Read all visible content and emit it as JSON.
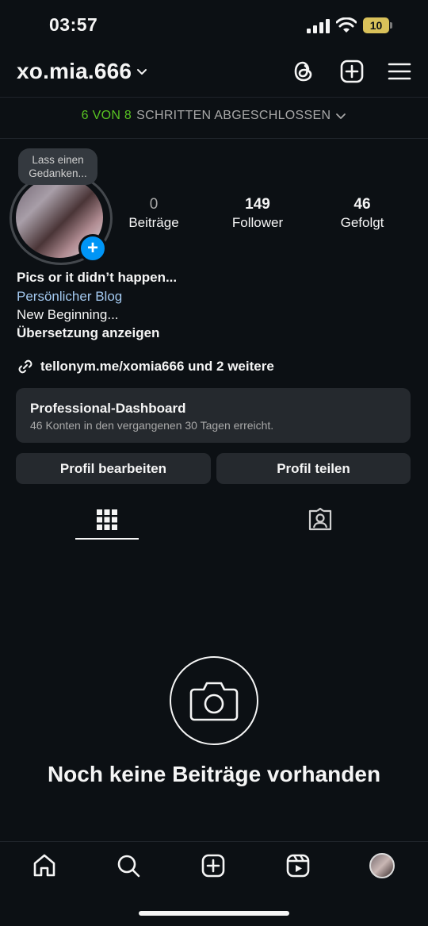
{
  "status_bar": {
    "time": "03:57",
    "battery": "10"
  },
  "header": {
    "username": "xo.mia.666",
    "icons": [
      "threads-icon",
      "create-post-icon",
      "menu-icon"
    ]
  },
  "steps": {
    "done": "6 VON 8",
    "rest": "SCHRITTEN ABGESCHLOSSEN"
  },
  "profile": {
    "note_bubble": "Lass einen Gedanken...",
    "stats": [
      {
        "value": "0",
        "label": "Beiträge"
      },
      {
        "value": "149",
        "label": "Follower"
      },
      {
        "value": "46",
        "label": "Gefolgt"
      }
    ]
  },
  "bio": {
    "name": "Pics or it didn’t happen...",
    "category": "Persönlicher Blog",
    "text": "New Beginning...",
    "translate": "Übersetzung anzeigen",
    "link": "tellonym.me/xomia666 und 2 weitere"
  },
  "dashboard": {
    "title": "Professional-Dashboard",
    "subtitle": "46 Konten in den vergangenen 30 Tagen erreicht."
  },
  "buttons": {
    "edit": "Profil bearbeiten",
    "share": "Profil teilen"
  },
  "tabs": {
    "active": "grid",
    "items": [
      "grid-icon",
      "tagged-icon"
    ]
  },
  "empty_state": {
    "title": "Noch keine Beiträge vorhanden"
  },
  "bottom_nav": {
    "items": [
      "home-icon",
      "search-icon",
      "create-icon",
      "reels-icon",
      "profile-avatar"
    ]
  },
  "colors": {
    "background": "#0c1014",
    "accent_green": "#58c322",
    "accent_blue": "#0095f6",
    "link_blue": "#a3c9f0",
    "surface": "#25292e"
  }
}
